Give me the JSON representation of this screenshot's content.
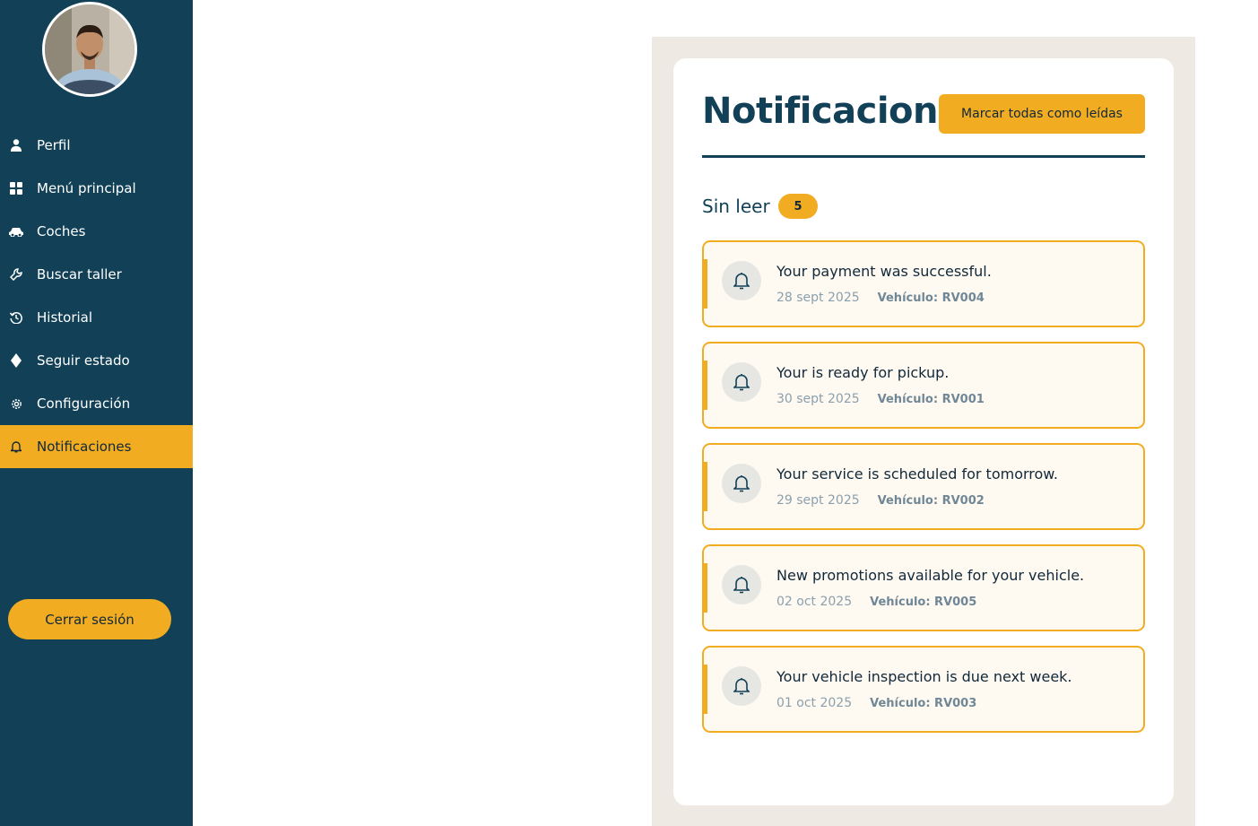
{
  "sidebar": {
    "avatar_icon": "user-avatar-photo",
    "items": [
      {
        "label": "Perfil",
        "icon": "user-icon"
      },
      {
        "label": "Menú principal",
        "icon": "grid-icon"
      },
      {
        "label": "Coches",
        "icon": "car-icon"
      },
      {
        "label": "Buscar taller",
        "icon": "wrench-icon"
      },
      {
        "label": "Historial",
        "icon": "history-icon"
      },
      {
        "label": "Seguir estado",
        "icon": "diamond-icon"
      },
      {
        "label": "Configuración",
        "icon": "gear-icon"
      },
      {
        "label": "Notificaciones",
        "icon": "bell-icon",
        "active": true
      }
    ],
    "logout_label": "Cerrar sesión"
  },
  "main": {
    "title": "Notificaciones",
    "mark_all_label": "Marcar todas como leídas",
    "unread_label": "Sin leer",
    "unread_count": "5",
    "notifications": [
      {
        "message": "Your payment was successful.",
        "date": "28 sept 2025",
        "vehicle": "Vehículo: RV004"
      },
      {
        "message": "Your is ready for pickup.",
        "date": "30 sept 2025",
        "vehicle": "Vehículo: RV001"
      },
      {
        "message": "Your service is scheduled for tomorrow.",
        "date": "29 sept 2025",
        "vehicle": "Vehículo: RV002"
      },
      {
        "message": "New promotions available for your vehicle.",
        "date": "02 oct 2025",
        "vehicle": "Vehículo: RV005"
      },
      {
        "message": "Your vehicle inspection is due next week.",
        "date": "01 oct 2025",
        "vehicle": "Vehículo: RV003"
      }
    ]
  },
  "colors": {
    "sidebar_bg": "#124157",
    "accent": "#f2ac21",
    "panel_bg": "#efe9e4",
    "card_item_bg": "#fffaf1"
  }
}
